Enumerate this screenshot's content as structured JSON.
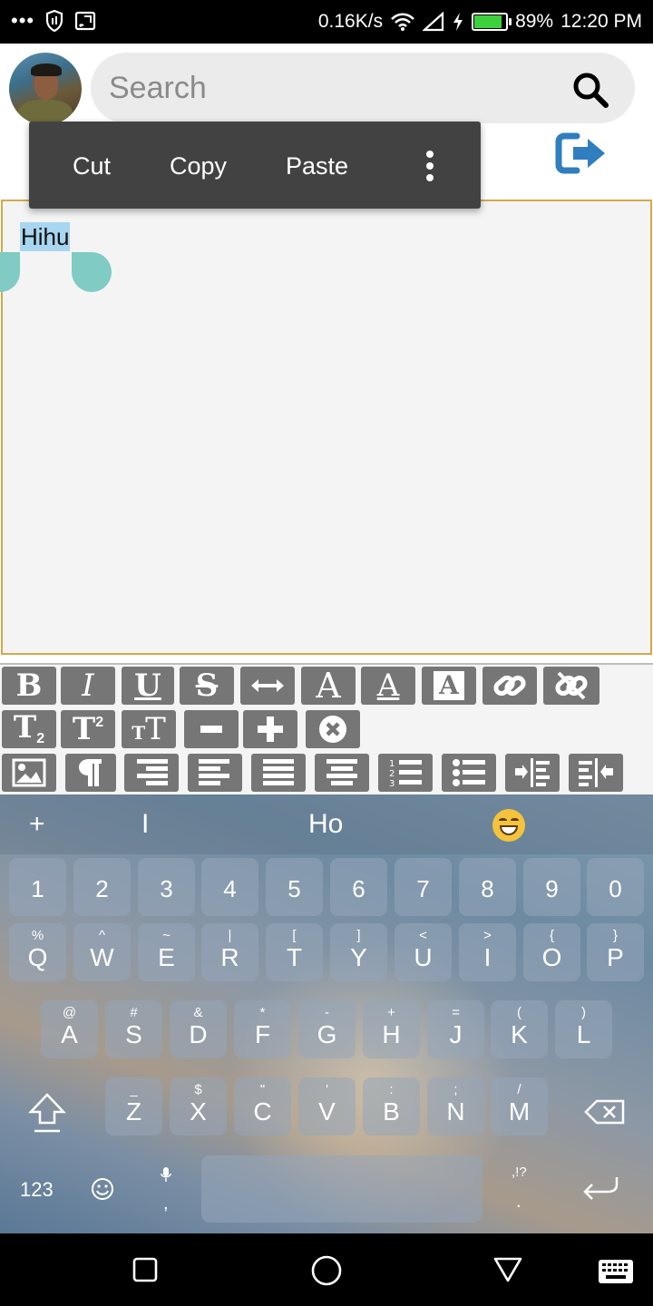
{
  "status_bar": {
    "net_speed": "0.16K/s",
    "battery_percent": "89%",
    "battery_level": 0.89,
    "time": "12:20 PM",
    "icons": [
      "more-dots-icon",
      "shield-icon",
      "cast-icon",
      "wifi-icon",
      "signal-icon",
      "charging-icon",
      "battery-icon"
    ]
  },
  "header": {
    "search_placeholder": "Search",
    "search_icon": "search-icon",
    "logout_icon": "logout-icon"
  },
  "context_menu": {
    "cut": "Cut",
    "copy": "Copy",
    "paste": "Paste",
    "more_icon": "more-vert-icon"
  },
  "editor": {
    "selected_text": "Hihu",
    "border_color": "#d4a94a",
    "selection_color": "#a8d6f0",
    "handle_color": "#80cbc4"
  },
  "toolbar": {
    "button_color": "#767676",
    "rows": [
      [
        "bold",
        "italic",
        "underline",
        "strikethrough",
        "text-width",
        "font-color",
        "font-underline-color",
        "background-color",
        "link",
        "unlink"
      ],
      [
        "subscript",
        "superscript",
        "text-size",
        "decrease",
        "increase",
        "remove-format"
      ],
      [
        "insert-image",
        "paragraph",
        "align-right",
        "align-left",
        "justify",
        "align-center",
        "ordered-list",
        "unordered-list",
        "indent",
        "outdent"
      ]
    ],
    "labels": {
      "bold": "B",
      "italic": "I",
      "underline": "U",
      "strike": "S",
      "font_color": "A",
      "sub_main": "T",
      "sub_small": "2",
      "sup_main": "T",
      "sup_small": "2",
      "size_big": "T",
      "size_small": "T"
    }
  },
  "keyboard": {
    "suggestions": {
      "plus": "+",
      "s1": "I",
      "s2": "Ho",
      "emoji": "grinning-squint-emoji"
    },
    "numbers": [
      "1",
      "2",
      "3",
      "4",
      "5",
      "6",
      "7",
      "8",
      "9",
      "0"
    ],
    "row1": [
      {
        "main": "Q",
        "sub": "%"
      },
      {
        "main": "W",
        "sub": "^"
      },
      {
        "main": "E",
        "sub": "~"
      },
      {
        "main": "R",
        "sub": "|"
      },
      {
        "main": "T",
        "sub": "["
      },
      {
        "main": "Y",
        "sub": "]"
      },
      {
        "main": "U",
        "sub": "<"
      },
      {
        "main": "I",
        "sub": ">"
      },
      {
        "main": "O",
        "sub": "{"
      },
      {
        "main": "P",
        "sub": "}"
      }
    ],
    "row2": [
      {
        "main": "A",
        "sub": "@"
      },
      {
        "main": "S",
        "sub": "#"
      },
      {
        "main": "D",
        "sub": "&"
      },
      {
        "main": "F",
        "sub": "*"
      },
      {
        "main": "G",
        "sub": "-"
      },
      {
        "main": "H",
        "sub": "+"
      },
      {
        "main": "J",
        "sub": "="
      },
      {
        "main": "K",
        "sub": "("
      },
      {
        "main": "L",
        "sub": ")"
      }
    ],
    "row3": [
      {
        "main": "Z",
        "sub": "_"
      },
      {
        "main": "X",
        "sub": "$"
      },
      {
        "main": "C",
        "sub": "\""
      },
      {
        "main": "V",
        "sub": "'"
      },
      {
        "main": "B",
        "sub": ":"
      },
      {
        "main": "N",
        "sub": ";"
      },
      {
        "main": "M",
        "sub": "/"
      }
    ],
    "bottom": {
      "num_toggle": "123",
      "comma": ",",
      "punct_sub": ",!?",
      "period": "."
    }
  },
  "nav_bar": {
    "icons": [
      "recents-icon",
      "home-icon",
      "back-icon",
      "keyboard-switch-icon"
    ]
  }
}
